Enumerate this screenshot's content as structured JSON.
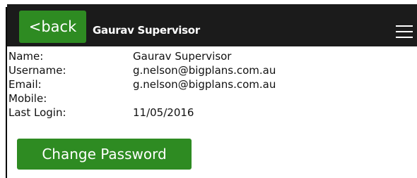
{
  "header": {
    "back_label": "<back",
    "title": "Gaurav Supervisor"
  },
  "profile": {
    "rows": [
      {
        "label": "Name:",
        "value": "Gaurav Supervisor"
      },
      {
        "label": "Username:",
        "value": "g.nelson@bigplans.com.au"
      },
      {
        "label": "Email:",
        "value": "g.nelson@bigplans.com.au"
      },
      {
        "label": "Mobile:",
        "value": ""
      },
      {
        "label": "Last Login:",
        "value": "11/05/2016"
      }
    ]
  },
  "actions": {
    "change_password_label": "Change Password"
  },
  "colors": {
    "header_bg": "#1b1b1b",
    "button_green": "#2e8b22"
  }
}
